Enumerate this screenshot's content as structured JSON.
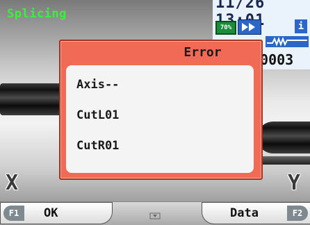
{
  "status": {
    "mode_text": "Splicing"
  },
  "info_panel": {
    "date_time": "11/26 13:01",
    "battery_percent": "70%",
    "forward_icon": "fast-forward-icon",
    "info_icon": "info-icon",
    "signal_icon": "waveform-icon",
    "counter": "00003"
  },
  "dialog": {
    "title": "Error",
    "messages": [
      "Axis--",
      "CutL01",
      "CutR01"
    ]
  },
  "axes": {
    "x_label": "X",
    "y_label": "Y"
  },
  "function_keys": {
    "f1_badge": "F1",
    "f1_label": "OK",
    "f2_badge": "F2",
    "f2_label": "Data",
    "center_icon": "chevron-down-icon"
  },
  "colors": {
    "status_green": "#38f23a",
    "dialog_red": "#f06a55",
    "accent_blue": "#2c67c7",
    "battery_green": "#1a8c3a"
  }
}
